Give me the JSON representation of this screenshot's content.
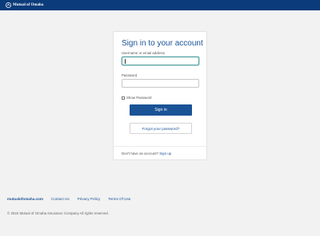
{
  "header": {
    "logo_text": "Mutual of Omaha",
    "icon": "mutual-of-omaha-logo",
    "background": "#0b3b7a"
  },
  "signin": {
    "title": "Sign in to your account",
    "username_label": "Username or email address",
    "username_value": "",
    "password_label": "Password",
    "password_value": "",
    "show_password_label": "Show Password",
    "show_password_checked": false,
    "signin_button": "Sign in",
    "forgot_button": "Forgot your password?",
    "no_account_text": "Don't have an account?",
    "signup_link": "Sign up"
  },
  "footer": {
    "brand_link": "mutualofomaha.com",
    "links": [
      "Contact Us",
      "Privacy Policy",
      "Terms Of Use"
    ],
    "copyright": "© 2022 Mutual of Omaha Insurance Company All rights reserved."
  },
  "colors": {
    "accent": "#1a5396",
    "page_bg": "#f2f2f2"
  }
}
